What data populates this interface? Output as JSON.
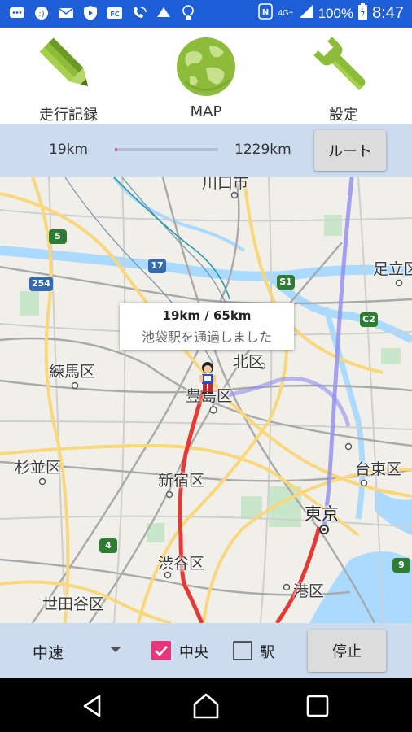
{
  "status_bar": {
    "network": "4G+",
    "battery": "100%",
    "time": "8:47",
    "icons": [
      "message-icon",
      "smiley-app-icon",
      "mail-icon",
      "shield-icon",
      "fc-app-icon",
      "wifi-call-icon",
      "notice-icon",
      "bulb-icon",
      "nfc-icon",
      "signal-icon",
      "battery-icon"
    ]
  },
  "tabs": [
    {
      "label": "走行記録",
      "icon": "pencil-icon"
    },
    {
      "label": "MAP",
      "icon": "globe-icon"
    },
    {
      "label": "設定",
      "icon": "wrench-icon"
    }
  ],
  "distance": {
    "start": "19km",
    "end": "1229km",
    "progress_fraction": 0.015,
    "route_button": "ルート"
  },
  "map": {
    "info_window": {
      "title": "19km / 65km",
      "subtitle": "池袋駅を通過しました"
    },
    "labels": {
      "kawaguchi": "川口市",
      "adachi": "足立区",
      "kita": "北区",
      "nerima": "練馬区",
      "toshima": "豊島区",
      "suginami": "杉並区",
      "shinjuku": "新宿区",
      "taito": "台東区",
      "tokyo": "東京",
      "shibuya": "渋谷区",
      "setagaya": "世田谷区",
      "minato": "港区"
    },
    "shields": {
      "r5": "5",
      "r17": "17",
      "r254": "254",
      "s1": "S1",
      "c2": "C2",
      "r4": "4",
      "r9": "9"
    },
    "colors": {
      "route_red": "#e53935",
      "route_purple": "#8e8cf0",
      "water": "#aadaff",
      "park": "#c8e6c9",
      "major_road": "#f9d77c"
    }
  },
  "controls": {
    "speed": "中速",
    "checkbox_chuo": {
      "label": "中央",
      "checked": true
    },
    "checkbox_eki": {
      "label": "駅",
      "checked": false
    },
    "stop_button": "停止"
  },
  "nav": [
    "back-icon",
    "home-icon",
    "recents-icon"
  ]
}
